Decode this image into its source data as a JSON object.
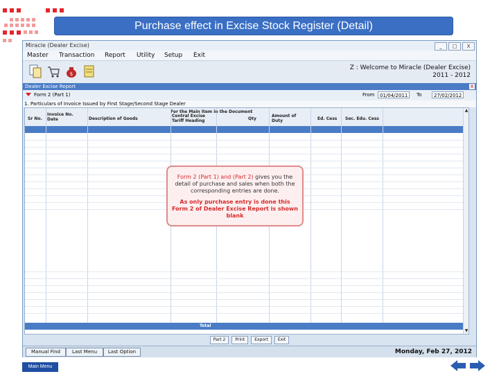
{
  "slide": {
    "title": "Purchase effect in Excise Stock Register (Detail)",
    "main_menu": "Main Menu",
    "nav_prev_icon": "back-arrow-icon",
    "nav_next_icon": "forward-arrow-icon"
  },
  "window": {
    "title": "Miracle (Dealer Excise)",
    "buttons": [
      "_",
      "□",
      "X"
    ]
  },
  "menu": [
    "Master",
    "Transaction",
    "Report",
    "Utility",
    "Setup",
    "Exit"
  ],
  "toolbar": {
    "icons": [
      "document-icon",
      "cart-icon",
      "money-bag-icon",
      "notepad-icon"
    ],
    "welcome": "Z : Welcome to Miracle (Dealer Excise)",
    "year": "2011 - 2012"
  },
  "panel": {
    "title": "Dealer Excise Report",
    "close": "X"
  },
  "form": {
    "name": "Form 2 (Part 1)",
    "from_label": "From",
    "from_value": "01/04/2011",
    "to_label": "To",
    "to_value": "27/02/2012"
  },
  "section": {
    "label": "1. Particulars of Invoice Issued by First Stage/Second Stage Dealer"
  },
  "grid": {
    "group_header": "For the Main Item in the Document",
    "columns": [
      "Sr No.",
      "Invoice No. Date",
      "Description of Goods",
      "Central Excise Tariff Heading",
      "Qty",
      "Amount of Duty",
      "Ed. Cess",
      "Sec. Edu. Cess"
    ],
    "total_label": "Total"
  },
  "actions": [
    "Part 2",
    "Print",
    "Export",
    "Exit"
  ],
  "statusbar": {
    "buttons": [
      "Manual Find",
      "Last Menu",
      "Last Option"
    ],
    "datetime": "Monday, Feb 27, 2012"
  },
  "callout": {
    "part1": "Form 2 (Part 1) and (Part 2)",
    "part2": " gives you the detail of purchase and sales when both the corresponding entries are done.",
    "part3": "As only purchase entry is done this Form 2 of Dealer Excise Report is shown blank"
  },
  "colors": {
    "accent": "#3a6fc4",
    "selection": "#4a7cc6",
    "callout_border": "#e08a8a",
    "callout_text": "#d62a2a"
  }
}
